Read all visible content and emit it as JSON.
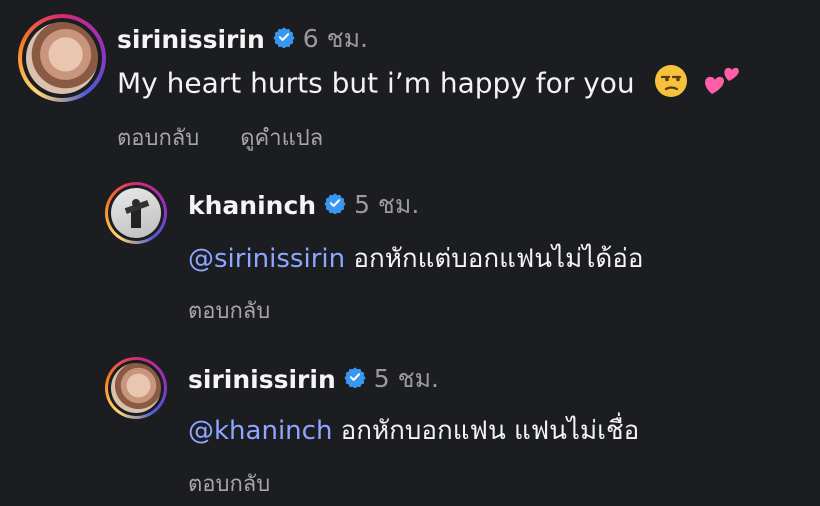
{
  "comments": [
    {
      "username": "sirinissirin",
      "time": "6 ชม.",
      "text": "My heart hurts but i’m happy for you",
      "emojis": [
        "unamused-face-emoji",
        "two-hearts-emoji"
      ],
      "actions": {
        "reply": "ตอบกลับ",
        "translate": "ดูคำแปล"
      }
    },
    {
      "username": "khaninch",
      "time": "5 ชม.",
      "mention": "@sirinissirin",
      "text": " อกหักแต่บอกแฟนไม่ได้อ่อ",
      "actions": {
        "reply": "ตอบกลับ"
      }
    },
    {
      "username": "sirinissirin",
      "time": "5 ชม.",
      "mention": "@khaninch",
      "text": " อกหักบอกแฟน แฟนไม่เชื่อ",
      "actions": {
        "reply": "ตอบกลับ"
      }
    }
  ],
  "colors": {
    "background": "#1b1d21",
    "mention": "#8ea6ff",
    "verified": "#3897f0",
    "secondary_text": "#a6a6a6"
  }
}
